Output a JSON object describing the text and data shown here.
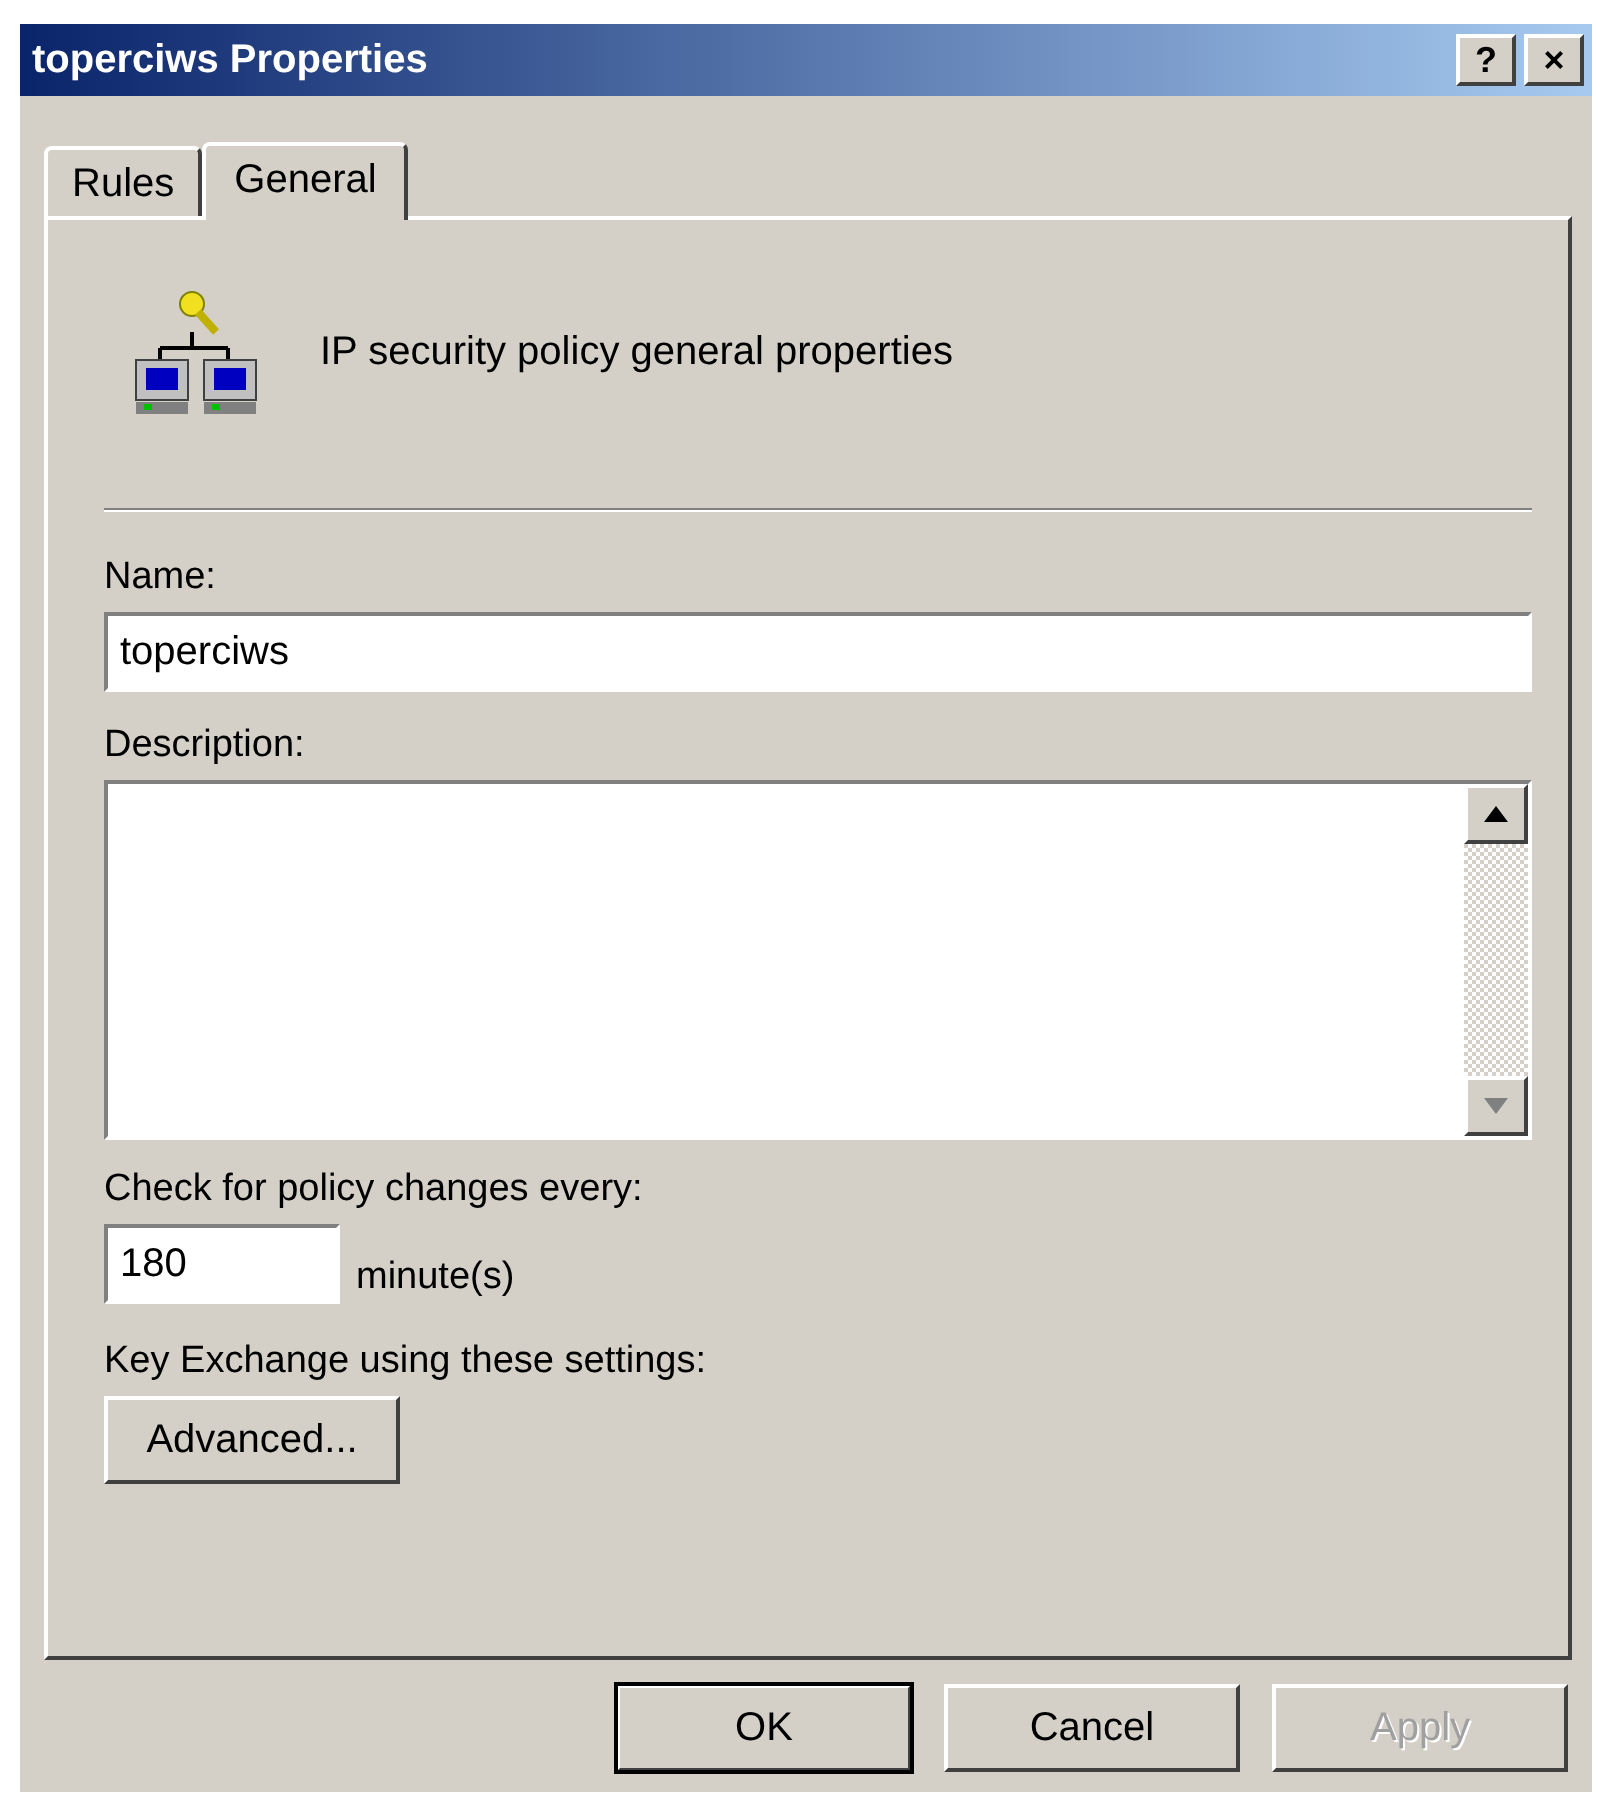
{
  "window": {
    "title": "toperciws Properties",
    "title_buttons": [
      "?",
      "×"
    ]
  },
  "tabs": [
    {
      "label": "Rules",
      "selected": false
    },
    {
      "label": "General",
      "selected": true
    }
  ],
  "heading": "IP security policy general properties",
  "name": {
    "label": "Name:",
    "value": "toperciws"
  },
  "description": {
    "label": "Description:"
  },
  "interval": {
    "label": "Check for policy changes every:",
    "value": "180",
    "unit": "minute(s)"
  },
  "key_exchange": {
    "label": "Key Exchange using these settings:",
    "button": "Advanced..."
  },
  "buttons": [
    {
      "label": "OK",
      "default": true,
      "disabled": false
    },
    {
      "label": "Cancel",
      "default": false,
      "disabled": false
    },
    {
      "label": "Apply",
      "default": false,
      "disabled": true
    }
  ]
}
